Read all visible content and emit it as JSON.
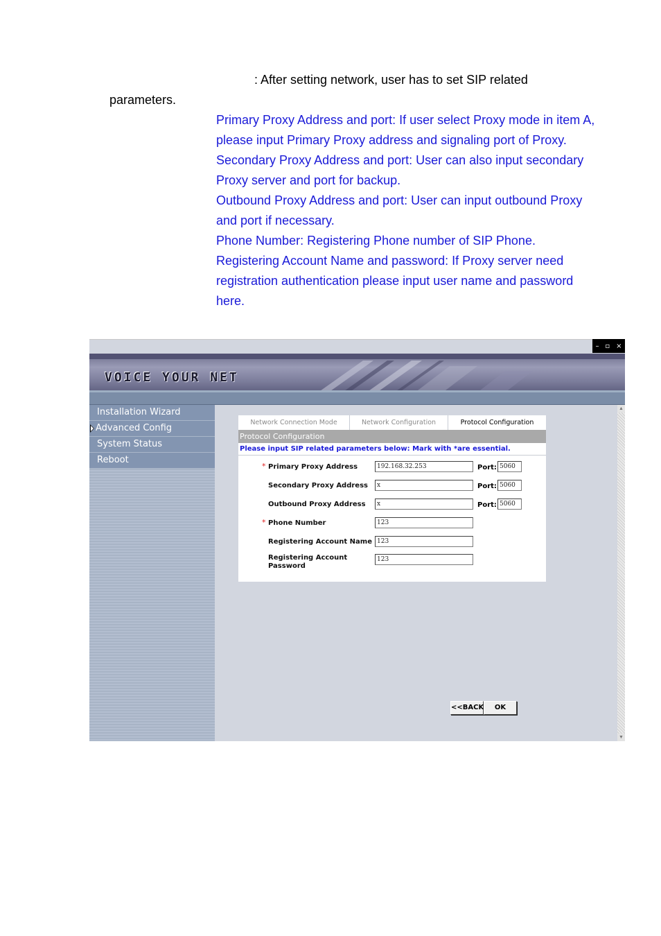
{
  "intro": {
    "line1": ": After setting network, user has to set SIP related",
    "line2": "parameters."
  },
  "description": [
    "Primary Proxy Address and port: If user select Proxy mode in item A, please input Primary Proxy address and signaling port of Proxy.",
    "Secondary Proxy Address and port: User can also input secondary Proxy server and port for backup.",
    "Outbound Proxy Address and port: User can input outbound Proxy and port if necessary.",
    "Phone Number: Registering Phone number of SIP Phone.",
    "Registering Account Name and password: If Proxy server need registration authentication please input user name and password here."
  ],
  "window": {
    "controls": [
      "–",
      "▫",
      "×"
    ]
  },
  "banner": {
    "logo": "VOICE YOUR NET"
  },
  "sidebar": {
    "items": [
      {
        "label": "Installation Wizard"
      },
      {
        "label": "Advanced Config"
      },
      {
        "label": "System Status"
      },
      {
        "label": "Reboot"
      }
    ]
  },
  "tabs": [
    {
      "label": "Network Connection Mode"
    },
    {
      "label": "Network Configuration"
    },
    {
      "label": "Protocol Configuration"
    }
  ],
  "form": {
    "section_title": "Protocol Configuration",
    "instruction": "Please input SIP related parameters below: Mark with *are essential.",
    "required_mark": "*",
    "port_label": "Port:",
    "fields": [
      {
        "label": "Primary Proxy Address",
        "value": "192.168.32.253",
        "port": "5060"
      },
      {
        "label": "Secondary Proxy Address",
        "value": "x",
        "port": "5060"
      },
      {
        "label": "Outbound Proxy Address",
        "value": "x",
        "port": "5060"
      },
      {
        "label": "Phone Number",
        "value": "123"
      },
      {
        "label": "Registering Account Name",
        "value": "123"
      },
      {
        "label": "Registering Account Password",
        "value": "123"
      }
    ]
  },
  "buttons": {
    "back": "<<BACK",
    "ok": "OK"
  },
  "colors": {
    "description_text": "#1a1ad8",
    "sidebar_item": "#8395b1",
    "content_bg": "#d2d6df",
    "section_header": "#a9a9a9",
    "required": "#e02020"
  }
}
